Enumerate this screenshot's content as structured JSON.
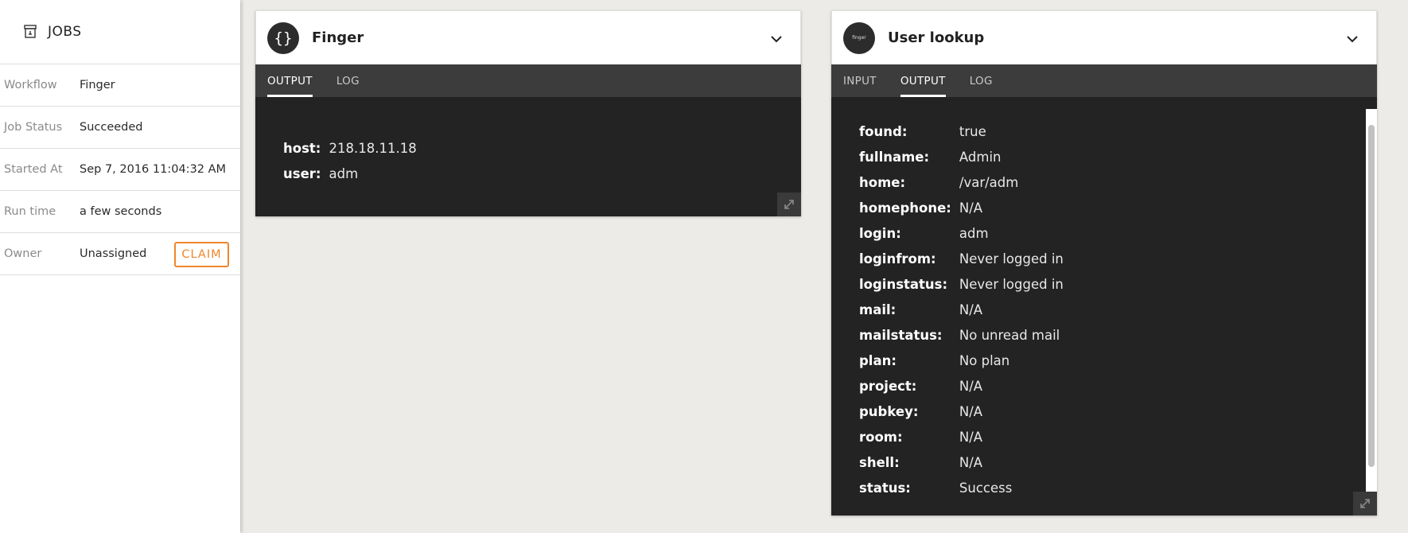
{
  "sidebar": {
    "title": "JOBS",
    "rows": [
      {
        "label": "Workflow",
        "value": "Finger"
      },
      {
        "label": "Job Status",
        "value": "Succeeded"
      },
      {
        "label": "Started At",
        "value": "Sep 7, 2016 11:04:32 AM"
      },
      {
        "label": "Run time",
        "value": "a few seconds"
      },
      {
        "label": "Owner",
        "value": "Unassigned"
      }
    ],
    "claim_label": "CLAIM"
  },
  "cards": {
    "finger": {
      "title": "Finger",
      "avatar": "{}",
      "tabs": [
        "OUTPUT",
        "LOG"
      ],
      "active_tab": "OUTPUT",
      "output": [
        {
          "key": "host:",
          "value": "218.18.11.18"
        },
        {
          "key": "user:",
          "value": "adm"
        }
      ]
    },
    "user_lookup": {
      "title": "User lookup",
      "avatar": "finger",
      "tabs": [
        "INPUT",
        "OUTPUT",
        "LOG"
      ],
      "active_tab": "OUTPUT",
      "output": [
        {
          "key": "found:",
          "value": "true"
        },
        {
          "key": "fullname:",
          "value": "Admin"
        },
        {
          "key": "home:",
          "value": "/var/adm"
        },
        {
          "key": "homephone:",
          "value": "N/A"
        },
        {
          "key": "login:",
          "value": "adm"
        },
        {
          "key": "loginfrom:",
          "value": "Never logged in"
        },
        {
          "key": "loginstatus:",
          "value": "Never logged in"
        },
        {
          "key": "mail:",
          "value": "N/A"
        },
        {
          "key": "mailstatus:",
          "value": "No unread mail"
        },
        {
          "key": "plan:",
          "value": "No plan"
        },
        {
          "key": "project:",
          "value": "N/A"
        },
        {
          "key": "pubkey:",
          "value": "N/A"
        },
        {
          "key": "room:",
          "value": "N/A"
        },
        {
          "key": "shell:",
          "value": "N/A"
        },
        {
          "key": "status:",
          "value": "Success"
        }
      ]
    }
  },
  "colors": {
    "accent": "#f0862b",
    "background": "#ecebe8",
    "card_body": "#232323",
    "tab_bar": "#3c3c3c"
  },
  "icons": {
    "sidebar": "archive-box-icon",
    "collapse": "chevron-down-icon",
    "expand": "expand-arrows-icon"
  }
}
